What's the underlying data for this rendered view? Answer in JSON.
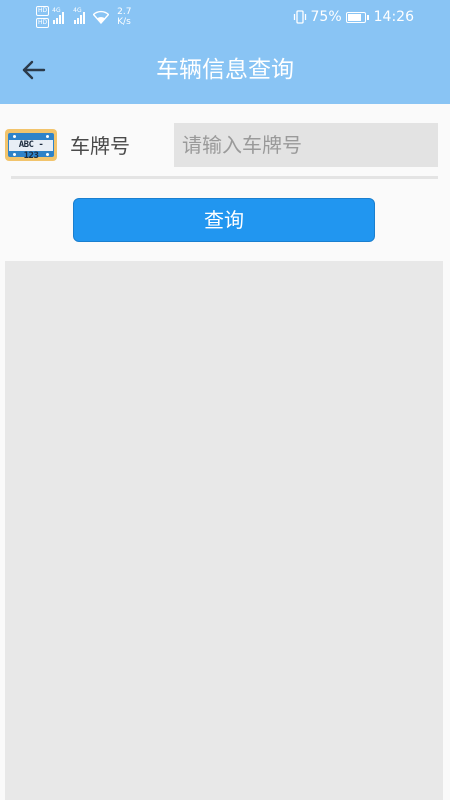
{
  "status_bar": {
    "hd1": "HD",
    "hd2": "HD",
    "net1": "4G",
    "net2": "4G",
    "speed_value": "2.7",
    "speed_unit": "K/s",
    "battery_percent": "75%",
    "battery_level": 0.75,
    "time": "14:26"
  },
  "header": {
    "title": "车辆信息查询",
    "back_icon": "arrow-left-icon"
  },
  "form": {
    "plate_icon_text": "ABC - 123",
    "label": "车牌号",
    "input_value": "",
    "input_placeholder": "请输入车牌号",
    "query_button_label": "查询"
  },
  "colors": {
    "header_bg": "#89c4f4",
    "button_bg": "#2196f0",
    "input_bg": "#e3e3e3",
    "results_bg": "#e8e8e8"
  }
}
